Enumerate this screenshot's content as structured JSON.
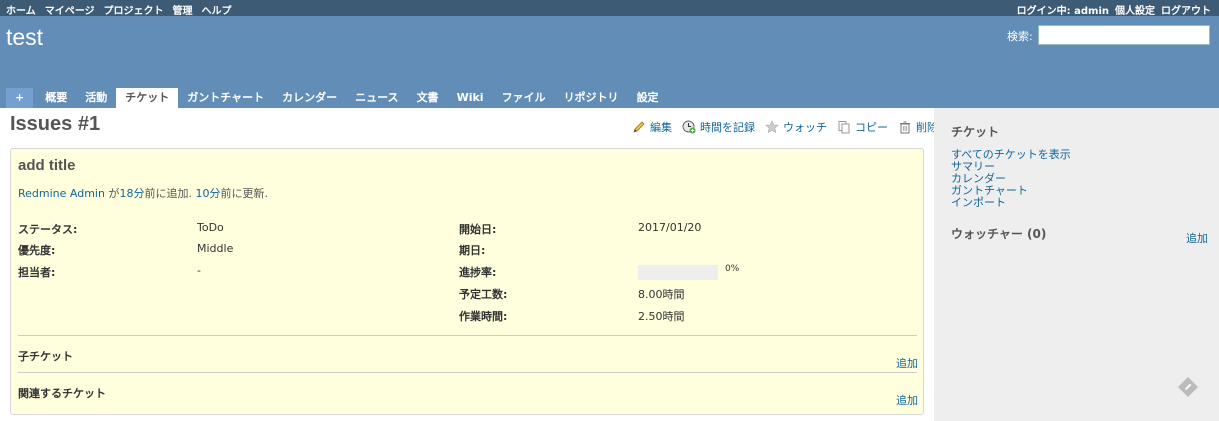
{
  "top_menu": {
    "items": [
      "ホーム",
      "マイページ",
      "プロジェクト",
      "管理",
      "ヘルプ"
    ],
    "logged_in_label": "ログイン中:",
    "user": "admin",
    "my_account": "個人設定",
    "logout": "ログアウト"
  },
  "header": {
    "project": "test",
    "search_label": "検索:",
    "search_value": ""
  },
  "main_menu": {
    "new": "+",
    "tabs": [
      "概要",
      "活動",
      "チケット",
      "ガントチャート",
      "カレンダー",
      "ニュース",
      "文書",
      "Wiki",
      "ファイル",
      "リポジトリ",
      "設定"
    ],
    "selected": "チケット"
  },
  "content": {
    "title": "Issues #1",
    "actions": [
      "編集",
      "時間を記録",
      "ウォッチ",
      "コピー",
      "削除"
    ]
  },
  "issue": {
    "subject": "add title",
    "author": "Redmine Admin",
    "added_ago": "18分",
    "added_suffix": "前に追加.",
    "updated_ago": "10分",
    "updated_suffix": "前に更新.",
    "left_attrs": [
      {
        "label": "ステータス:",
        "value": "ToDo"
      },
      {
        "label": "優先度:",
        "value": "Middle"
      },
      {
        "label": "担当者:",
        "value": "-"
      }
    ],
    "right_attrs": [
      {
        "label": "開始日:",
        "value": "2017/01/20"
      },
      {
        "label": "期日:",
        "value": ""
      },
      {
        "label": "進捗率:",
        "value": "0%"
      },
      {
        "label": "予定工数:",
        "value": "8.00時間"
      },
      {
        "label": "作業時間:",
        "value": "2.50時間"
      }
    ],
    "progress": 0,
    "subtasks_title": "子チケット",
    "relations_title": "関連するチケット",
    "add_label": "追加"
  },
  "sidebar": {
    "tickets_title": "チケット",
    "links": [
      "すべてのチケットを表示",
      "サマリー",
      "カレンダー",
      "ガントチャート",
      "インポート"
    ],
    "watchers_title": "ウォッチャー (0)",
    "watchers_add": "追加"
  },
  "colors": {
    "top_menu_bg": "#3e5b76",
    "header_bg": "#628db6",
    "link": "#116699",
    "issue_bg": "#ffffdd",
    "sidebar_bg": "#eeeeee"
  }
}
